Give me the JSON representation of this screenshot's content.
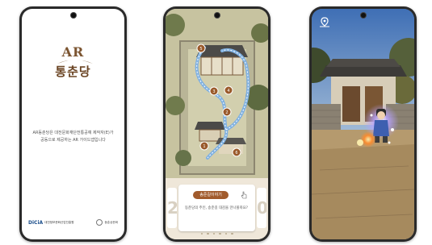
{
  "splash": {
    "logo_ar": "AR",
    "logo_main": "통춘당",
    "intro_line1": "AR동춘당은 대전문화재단전통공예 제작자(E)가",
    "intro_line2": "공동으로 제공하는 AR 가이드앱입니다",
    "footer_left_brand": "DiCiA",
    "footer_left_org": "대전정보문화산업진흥원",
    "footer_right_org": "동춘상문화"
  },
  "map": {
    "pins": [
      "5",
      "3",
      "4",
      "2",
      "1",
      "6"
    ],
    "card_prev_number": "2",
    "card_next_number": "0",
    "story_button_label": "송준길이야기",
    "story_text": "동춘당의 주인, 송준길 대감을 만나볼까요?"
  },
  "colors": {
    "brand_brown": "#6b4524",
    "button_brown": "#a15b2c",
    "path_blue": "#7fb0e0",
    "dicia_blue": "#1b4e8b"
  },
  "icons": {
    "map_pin": "map-pin-icon",
    "hand": "hand-pointer-icon",
    "location": "location-pin-icon"
  }
}
